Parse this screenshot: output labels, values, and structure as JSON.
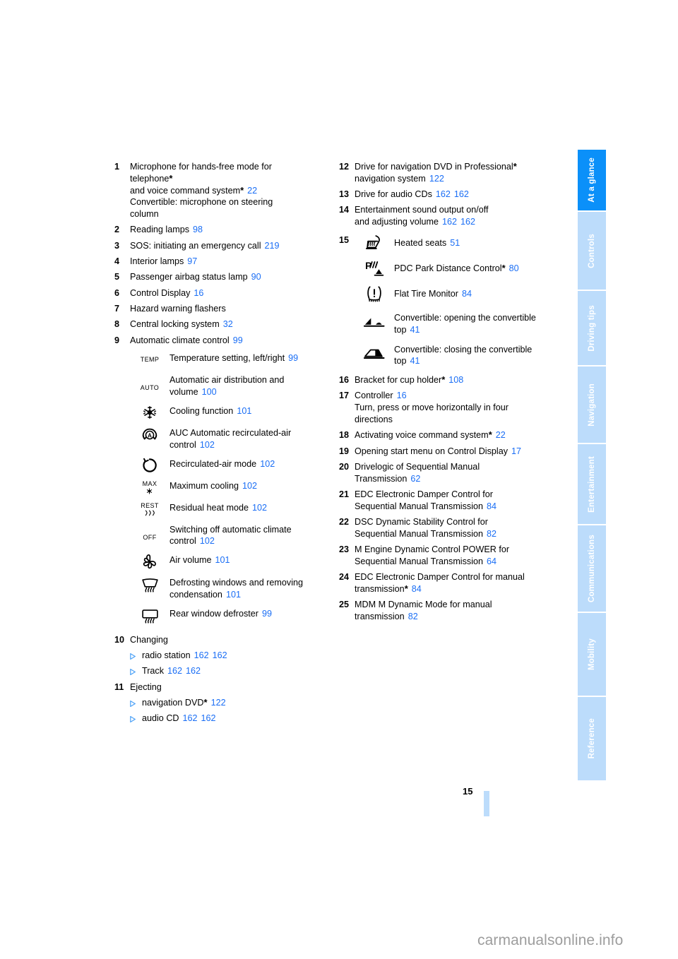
{
  "document": {
    "page_number": "15",
    "watermark": "carmanualsonline.info"
  },
  "tabs": [
    {
      "label": "At a glance",
      "active": true
    },
    {
      "label": "Controls",
      "active": false
    },
    {
      "label": "Driving tips",
      "active": false
    },
    {
      "label": "Navigation",
      "active": false
    },
    {
      "label": "Entertainment",
      "active": false
    },
    {
      "label": "Communications",
      "active": false
    },
    {
      "label": "Mobility",
      "active": false
    },
    {
      "label": "Reference",
      "active": false
    }
  ],
  "colors": {
    "tab_active": "#0b90f9",
    "tab_inactive": "#bcdcfb",
    "page_link": "#1a6ef5",
    "bullet": "#4da2f7"
  },
  "left_column": {
    "items": [
      {
        "num": "1",
        "lines": [
          {
            "text": "Microphone for hands-free mode for"
          },
          {
            "text": "telephone",
            "star": true
          },
          {
            "text": "and voice command system",
            "star": true,
            "page": "22"
          },
          {
            "text": "Convertible: microphone on steering"
          },
          {
            "text": "column"
          }
        ]
      },
      {
        "num": "2",
        "lines": [
          {
            "text": "Reading lamps",
            "page": "98"
          }
        ]
      },
      {
        "num": "3",
        "lines": [
          {
            "text": "SOS: initiating an emergency call",
            "page": "219"
          }
        ]
      },
      {
        "num": "4",
        "lines": [
          {
            "text": "Interior lamps",
            "page": "97"
          }
        ]
      },
      {
        "num": "5",
        "lines": [
          {
            "text": "Passenger airbag status lamp",
            "page": "90"
          }
        ]
      },
      {
        "num": "6",
        "lines": [
          {
            "text": "Control Display",
            "page": "16"
          }
        ]
      },
      {
        "num": "7",
        "lines": [
          {
            "text": "Hazard warning flashers"
          }
        ]
      },
      {
        "num": "8",
        "lines": [
          {
            "text": "Central locking system",
            "page": "32"
          }
        ]
      },
      {
        "num": "9",
        "lines": [
          {
            "text": "Automatic climate control",
            "page": "99"
          }
        ]
      }
    ],
    "climate_icons": [
      {
        "icon": "temp-icon",
        "icon_text": "TEMP",
        "label": "Temperature setting, left/right",
        "page": "99"
      },
      {
        "icon": "auto-icon",
        "icon_text": "AUTO",
        "label": "Automatic air distribution and volume",
        "page": "100"
      },
      {
        "icon": "snowflake-icon",
        "label": "Cooling function",
        "page": "101"
      },
      {
        "icon": "auc-recirculation-icon",
        "label": "AUC Automatic recirculated-air control",
        "page": "102"
      },
      {
        "icon": "recirculated-air-icon",
        "label": "Recirculated-air mode",
        "page": "102"
      },
      {
        "icon": "max-cooling-icon",
        "icon_text": "MAX",
        "label": "Maximum cooling",
        "page": "102"
      },
      {
        "icon": "residual-heat-icon",
        "icon_text": "REST",
        "label": "Residual heat mode",
        "page": "102"
      },
      {
        "icon": "off-icon",
        "icon_text": "OFF",
        "label": "Switching off automatic climate control",
        "page": "102"
      },
      {
        "icon": "fan-icon",
        "label": "Air volume",
        "page": "101"
      },
      {
        "icon": "windshield-defrost-icon",
        "label": "Defrosting windows and removing condensation",
        "page": "101"
      },
      {
        "icon": "rear-defroster-icon",
        "label": "Rear window defroster",
        "page": "99"
      }
    ],
    "items_after": [
      {
        "num": "10",
        "title": "Changing",
        "subs": [
          {
            "text": "radio station",
            "pages": [
              "162",
              "162"
            ]
          },
          {
            "text": "Track",
            "pages": [
              "162",
              "162"
            ]
          }
        ]
      },
      {
        "num": "11",
        "title": "Ejecting",
        "subs": [
          {
            "text": "navigation DVD",
            "star": true,
            "pages": [
              "122"
            ]
          },
          {
            "text": "audio CD",
            "pages": [
              "162",
              "162"
            ]
          }
        ]
      }
    ]
  },
  "right_column": {
    "items_before": [
      {
        "num": "12",
        "lines": [
          {
            "text": "Drive for navigation DVD in Professional",
            "star": true
          },
          {
            "text": "navigation system",
            "page": "122"
          }
        ]
      },
      {
        "num": "13",
        "lines": [
          {
            "text": "Drive for audio CDs",
            "page": "162",
            "page2": "162"
          }
        ]
      },
      {
        "num": "14",
        "lines": [
          {
            "text": "Entertainment sound output on/off"
          },
          {
            "text": "and adjusting volume",
            "page": "162",
            "page2": "162"
          }
        ]
      }
    ],
    "group15": {
      "num": "15",
      "icons": [
        {
          "icon": "heated-seat-icon",
          "label": "Heated seats",
          "page": "51"
        },
        {
          "icon": "pdc-icon",
          "label": "PDC Park Distance Control",
          "star": true,
          "page": "80"
        },
        {
          "icon": "flat-tire-monitor-icon",
          "label": "Flat Tire Monitor",
          "page": "84"
        },
        {
          "icon": "convertible-top-open-icon",
          "label": "Convertible: opening the convertible top",
          "page": "41"
        },
        {
          "icon": "convertible-top-close-icon",
          "label": "Convertible: closing the convertible top",
          "page": "41"
        }
      ]
    },
    "items_after": [
      {
        "num": "16",
        "lines": [
          {
            "text": "Bracket for cup holder",
            "star": true,
            "page": "108"
          }
        ]
      },
      {
        "num": "17",
        "lines": [
          {
            "text": "Controller",
            "page": "16"
          },
          {
            "text": "Turn, press or move horizontally in four"
          },
          {
            "text": "directions"
          }
        ]
      },
      {
        "num": "18",
        "lines": [
          {
            "text": "Activating voice command system",
            "star": true,
            "page": "22"
          }
        ]
      },
      {
        "num": "19",
        "lines": [
          {
            "text": "Opening start menu on Control Display",
            "page": "17"
          }
        ]
      },
      {
        "num": "20",
        "lines": [
          {
            "text": "Drivelogic of Sequential Manual"
          },
          {
            "text": "Transmission",
            "page": "62"
          }
        ]
      },
      {
        "num": "21",
        "lines": [
          {
            "text": "EDC Electronic Damper Control for"
          },
          {
            "text": "Sequential Manual Transmission",
            "page": "84"
          }
        ]
      },
      {
        "num": "22",
        "lines": [
          {
            "text": "DSC Dynamic Stability Control for"
          },
          {
            "text": "Sequential Manual Transmission",
            "page": "82"
          }
        ]
      },
      {
        "num": "23",
        "lines": [
          {
            "text": "M Engine Dynamic Control POWER for"
          },
          {
            "text": "Sequential Manual Transmission",
            "page": "64"
          }
        ]
      },
      {
        "num": "24",
        "lines": [
          {
            "text": "EDC Electronic Damper Control for manual"
          },
          {
            "text": "transmission",
            "star": true,
            "page": "84"
          }
        ]
      },
      {
        "num": "25",
        "lines": [
          {
            "text": "MDM M Dynamic Mode for manual"
          },
          {
            "text": "transmission",
            "page": "82"
          }
        ]
      }
    ]
  }
}
